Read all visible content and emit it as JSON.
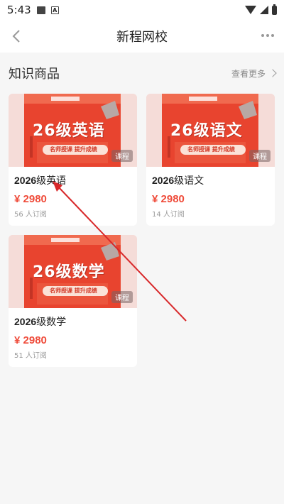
{
  "status_bar": {
    "time": "5:43"
  },
  "header": {
    "title": "新程网校"
  },
  "section": {
    "title": "知识商品",
    "more_label": "查看更多"
  },
  "products": [
    {
      "poster_title": "26级英语",
      "poster_slogan": "名师授课 提升成绩",
      "badge": "课程",
      "title_num": "2026",
      "title_cn": "级英语",
      "price": "¥ 2980",
      "subs": "56 人订阅"
    },
    {
      "poster_title": "26级语文",
      "poster_slogan": "名师授课 提升成绩",
      "badge": "课程",
      "title_num": "2026",
      "title_cn": "级语文",
      "price": "¥ 2980",
      "subs": "14 人订阅"
    },
    {
      "poster_title": "26级数学",
      "poster_slogan": "名师授课 提升成绩",
      "badge": "课程",
      "title_num": "2026",
      "title_cn": "级数学",
      "price": "¥ 2980",
      "subs": "51 人订阅"
    }
  ],
  "colors": {
    "accent": "#ef4b3a",
    "poster_red": "#e8442f",
    "annotation_arrow": "#d8282a"
  },
  "icons": {
    "back": "chevron-left-icon",
    "more": "more-dots-icon",
    "section_more": "chevron-right-icon"
  }
}
